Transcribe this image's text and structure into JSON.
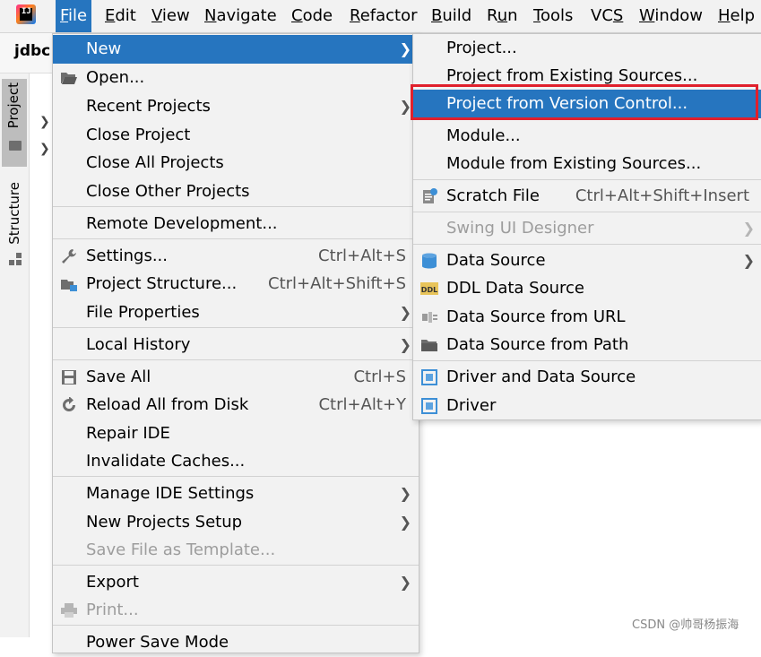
{
  "menubar": {
    "logo_text": "IJ",
    "items": [
      {
        "label": "File",
        "mnemonic": "F"
      },
      {
        "label": "Edit",
        "mnemonic": "E"
      },
      {
        "label": "View",
        "mnemonic": "V"
      },
      {
        "label": "Navigate",
        "mnemonic": "N"
      },
      {
        "label": "Code",
        "mnemonic": "C"
      },
      {
        "label": "Refactor",
        "mnemonic": "R"
      },
      {
        "label": "Build",
        "mnemonic": "B"
      },
      {
        "label": "Run",
        "mnemonic": "u"
      },
      {
        "label": "Tools",
        "mnemonic": "T"
      },
      {
        "label": "VCS",
        "mnemonic": "S"
      },
      {
        "label": "Window",
        "mnemonic": "W"
      },
      {
        "label": "Help",
        "mnemonic": "H"
      }
    ]
  },
  "project_name": "jdbc",
  "tool_windows": {
    "project": "Project",
    "structure": "Structure"
  },
  "file_menu": {
    "items": [
      {
        "label": "New",
        "shortcut": "",
        "submenu": true,
        "selected": true
      },
      {
        "label": "Open...",
        "shortcut": "",
        "icon": "folder-open-icon"
      },
      {
        "label": "Recent Projects",
        "shortcut": "",
        "submenu": true
      },
      {
        "label": "Close Project",
        "shortcut": ""
      },
      {
        "label": "Close All Projects",
        "shortcut": ""
      },
      {
        "label": "Close Other Projects",
        "shortcut": ""
      },
      {
        "label": "Remote Development...",
        "shortcut": ""
      },
      {
        "label": "Settings...",
        "shortcut": "Ctrl+Alt+S",
        "icon": "wrench-icon"
      },
      {
        "label": "Project Structure...",
        "shortcut": "Ctrl+Alt+Shift+S",
        "icon": "project-structure-icon"
      },
      {
        "label": "File Properties",
        "shortcut": "",
        "submenu": true
      },
      {
        "label": "Local History",
        "shortcut": "",
        "submenu": true
      },
      {
        "label": "Save All",
        "shortcut": "Ctrl+S",
        "icon": "save-icon"
      },
      {
        "label": "Reload All from Disk",
        "shortcut": "Ctrl+Alt+Y",
        "icon": "reload-icon"
      },
      {
        "label": "Repair IDE",
        "shortcut": ""
      },
      {
        "label": "Invalidate Caches...",
        "shortcut": ""
      },
      {
        "label": "Manage IDE Settings",
        "shortcut": "",
        "submenu": true
      },
      {
        "label": "New Projects Setup",
        "shortcut": "",
        "submenu": true
      },
      {
        "label": "Save File as Template...",
        "shortcut": "",
        "disabled": true
      },
      {
        "label": "Export",
        "shortcut": "",
        "submenu": true
      },
      {
        "label": "Print...",
        "shortcut": "",
        "disabled": true,
        "icon": "print-icon"
      },
      {
        "label": "Power Save Mode",
        "shortcut": ""
      }
    ]
  },
  "new_menu": {
    "items": [
      {
        "label": "Project...",
        "shortcut": ""
      },
      {
        "label": "Project from Existing Sources...",
        "shortcut": ""
      },
      {
        "label": "Project from Version Control...",
        "shortcut": "",
        "selected": true
      },
      {
        "label": "Module...",
        "shortcut": ""
      },
      {
        "label": "Module from Existing Sources...",
        "shortcut": ""
      },
      {
        "label": "Scratch File",
        "shortcut": "Ctrl+Alt+Shift+Insert",
        "icon": "scratch-file-icon"
      },
      {
        "label": "Swing UI Designer",
        "shortcut": "",
        "submenu": true,
        "disabled": true
      },
      {
        "label": "Data Source",
        "shortcut": "",
        "submenu": true,
        "icon": "database-icon"
      },
      {
        "label": "DDL Data Source",
        "shortcut": "",
        "icon": "ddl-icon"
      },
      {
        "label": "Data Source from URL",
        "shortcut": "",
        "icon": "plug-icon"
      },
      {
        "label": "Data Source from Path",
        "shortcut": "",
        "icon": "folder-icon"
      },
      {
        "label": "Driver and Data Source",
        "shortcut": "",
        "icon": "driver-icon"
      },
      {
        "label": "Driver",
        "shortcut": "",
        "icon": "driver-icon"
      }
    ]
  },
  "watermark": "CSDN @帅哥杨振海",
  "colors": {
    "selection": "#2675bf",
    "highlight_border": "#e0202c",
    "menu_bg": "#f2f2f2"
  }
}
